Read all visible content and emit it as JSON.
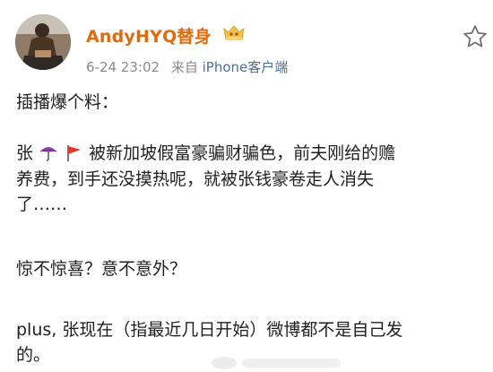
{
  "post": {
    "username": "AndyHYQ替身",
    "timestamp": "6-24 23:02",
    "source_prefix": "来自",
    "source_client": "iPhone客户端",
    "lines": [
      "插播爆个料：",
      "",
      "张",
      "被新加坡假富豪骗财骗色，前夫刚给的赡",
      "养费，到手还没摸热呢，就被张钱豪卷走人消失",
      "了……",
      "",
      "惊不惊喜？意不意外？",
      "",
      "plus, 张现在（指最近几日开始）微博都不是自己发",
      "的。"
    ]
  },
  "icons": {
    "vip": "crown-badge-icon",
    "favorite": "star-outline-icon",
    "umbrella": "umbrella-emoji-icon",
    "flag": "red-flag-emoji-icon"
  },
  "colors": {
    "username": "#e06a0e",
    "meta": "#8b8b8b",
    "client": "#4b6f9c",
    "text": "#1f1f1f"
  }
}
